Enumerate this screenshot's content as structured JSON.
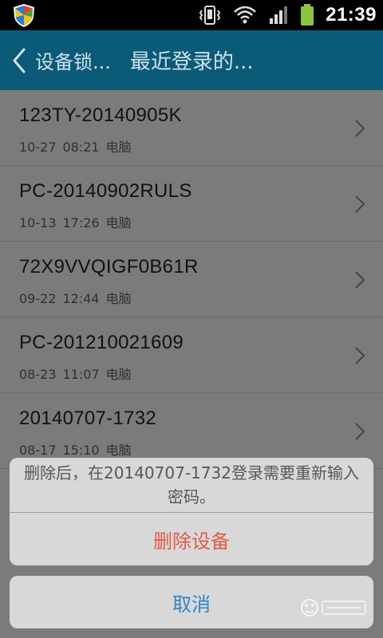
{
  "status": {
    "time": "21:39"
  },
  "header": {
    "back_title": "设备锁...",
    "title": "最近登录的..."
  },
  "devices": [
    {
      "name": "123TY-20140905K",
      "date": "10-27",
      "time": "08:21",
      "type": "电脑"
    },
    {
      "name": "PC-20140902RULS",
      "date": "10-13",
      "time": "17:26",
      "type": "电脑"
    },
    {
      "name": "72X9VVQIGF0B61R",
      "date": "09-22",
      "time": "12:44",
      "type": "电脑"
    },
    {
      "name": "PC-201210021609",
      "date": "08-23",
      "time": "11:07",
      "type": "电脑"
    },
    {
      "name": "20140707-1732",
      "date": "08-17",
      "time": "15:10",
      "type": "电脑"
    }
  ],
  "dialog": {
    "message": "删除后，在20140707-1732登录需要重新输入密码。",
    "delete_label": "删除设备",
    "cancel_label": "取消"
  },
  "colors": {
    "header": "#0b5a78",
    "delete": "#e45a4a",
    "cancel": "#2f86c9"
  }
}
